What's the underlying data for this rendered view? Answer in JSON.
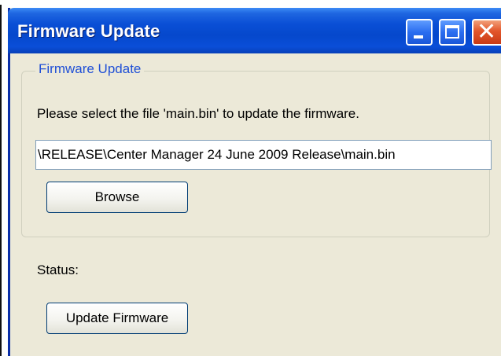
{
  "window": {
    "title": "Firmware Update",
    "controls": {
      "minimize": "minimize-icon",
      "maximize": "maximize-icon",
      "close": "close-icon"
    }
  },
  "group": {
    "legend": "Firmware Update",
    "instruction": "Please select the file 'main.bin' to update the firmware.",
    "path_value": "\\RELEASE\\Center Manager 24 June 2009 Release\\main.bin",
    "browse_label": "Browse"
  },
  "status": {
    "label": "Status:"
  },
  "actions": {
    "update_label": "Update Firmware"
  },
  "colors": {
    "titlebar": "#0548cc",
    "window_bg": "#ece9d8",
    "legend_text": "#1f4fd6",
    "close_button": "#e2562b"
  }
}
